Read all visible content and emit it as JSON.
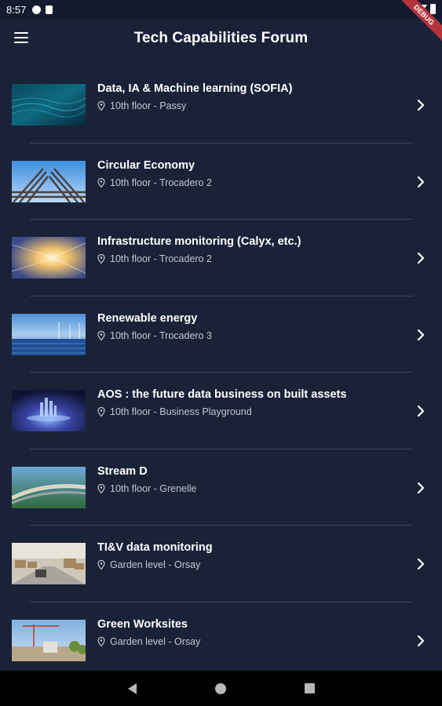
{
  "status_bar": {
    "time": "8:57",
    "debug_label": "DEBUG"
  },
  "app_bar": {
    "title": "Tech Capabilities Forum"
  },
  "items": [
    {
      "title": "Data, IA & Machine learning (SOFIA)",
      "location": "10th floor - Passy",
      "image": "ocean-data"
    },
    {
      "title": "Circular Economy",
      "location": "10th floor - Trocadero 2",
      "image": "steel-rods"
    },
    {
      "title": "Infrastructure monitoring (Calyx, etc.)",
      "location": "10th floor - Trocadero 2",
      "image": "light-tunnel"
    },
    {
      "title": "Renewable energy",
      "location": "10th floor - Trocadero 3",
      "image": "solar-wind"
    },
    {
      "title": "AOS : the future data business on built assets",
      "location": "10th floor - Business Playground",
      "image": "holo-city"
    },
    {
      "title": "Stream D",
      "location": "10th floor - Grenelle",
      "image": "highway"
    },
    {
      "title": "TI&V data monitoring",
      "location": "Garden level - Orsay",
      "image": "warehouse"
    },
    {
      "title": "Green Worksites",
      "location": "Garden level - Orsay",
      "image": "crane"
    }
  ],
  "colors": {
    "background": "#1a2238",
    "divider": "#3c4560",
    "text_secondary": "#c3c7d1"
  }
}
